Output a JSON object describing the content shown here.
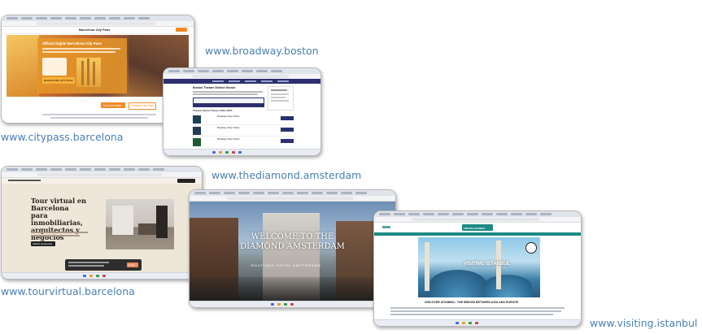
{
  "captions": {
    "citypass": "www.citypass.barcelona",
    "broadway": "www.broadway.boston",
    "tourvirtual": "www.tourvirtual.barcelona",
    "thediamond": "www.thediamond.amsterdam",
    "visiting": "www.visiting.istanbul"
  },
  "citypass": {
    "site_name": "Barcelona City Pass",
    "hero_title": "Official Digital Barcelona City Pass",
    "card_label": "BARCELONA CITY PASS",
    "primary_button": "Comprar tarjeta",
    "secondary_button": "Comprar City Pass"
  },
  "broadway": {
    "heading": "Boston Theatre District Shows",
    "section_title": "Theatre District Shows 2024–2025",
    "events": [
      "Broadway Show Tickets",
      "Broadway Show Tickets",
      "Broadway Show Tickets"
    ]
  },
  "tourvirtual": {
    "headline": "Tour virtual en Barcelona para inmobiliarias, arquitectos y negocios",
    "cta": "Solicitar presupuesto",
    "cookie_button": "Aceptar"
  },
  "thediamond": {
    "headline": "WELCOME TO THE DIAMOND AMSTERDAM",
    "subline": "BOUTIQUE HOTEL AMSTERDAM"
  },
  "visiting": {
    "logo": "VISITING ISTANBUL",
    "hero_text": "VISITING ISTANBUL",
    "tagline": "DISCOVER ISTANBUL: THE BRIDGE BETWEEN ASIA AND EUROPE"
  },
  "colors": {
    "caption": "#4a7fb5",
    "citypass_orange": "#f08a24",
    "broadway_navy": "#2d2f6e",
    "visiting_teal": "#1e8a86",
    "tourvirtual_beige": "#efe6da"
  }
}
